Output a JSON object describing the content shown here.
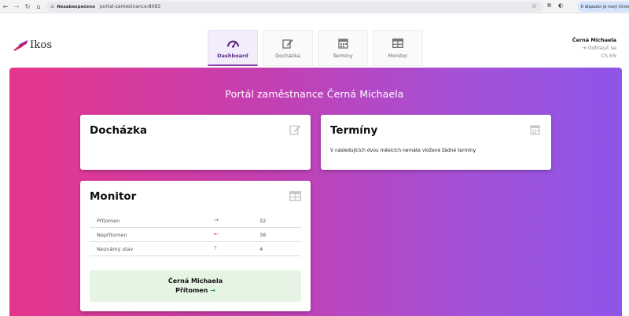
{
  "browser": {
    "security_label": "Nezabezpečeno",
    "url": "portal-zamestnance:8083",
    "chrome_notice": "K dispozici je nový Chrome"
  },
  "app": {
    "logo_text": "Ikos",
    "tabs": [
      {
        "label": "Dashboard",
        "icon": "gauge-icon",
        "active": true
      },
      {
        "label": "Docházka",
        "icon": "edit-icon",
        "active": false
      },
      {
        "label": "Termíny",
        "icon": "calendar-icon",
        "active": false
      },
      {
        "label": "Monitor",
        "icon": "table-icon",
        "active": false
      }
    ],
    "user": {
      "name": "Černá Michaela",
      "logout_label": "Odhlásit se",
      "languages": "CS EN"
    }
  },
  "main": {
    "portal_title": "Portál zaměstnance Černá Michaela",
    "cards": {
      "dochazka": {
        "title": "Docházka",
        "icon": "edit-icon"
      },
      "terminy": {
        "title": "Termíny",
        "icon": "calendar-icon",
        "message": "V následujících dvou měsících nemáte vložené žádné termíny"
      },
      "monitor": {
        "title": "Monitor",
        "icon": "table-icon",
        "rows": [
          {
            "label": "Přítomen",
            "arrow": "→",
            "count": "32"
          },
          {
            "label": "Nepřítomen",
            "arrow": "←",
            "count": "38"
          },
          {
            "label": "Neznámý stav",
            "arrow": "?",
            "count": "4"
          }
        ],
        "status_name": "Černá Michaela",
        "status_text": "Přítomen",
        "status_arrow": "→"
      }
    }
  },
  "colors": {
    "gradient_start": "#e6368c",
    "gradient_end": "#8e55e8",
    "present": "#1e9e3a",
    "absent": "#d33b2c",
    "status_bg": "#e6f5e3"
  }
}
